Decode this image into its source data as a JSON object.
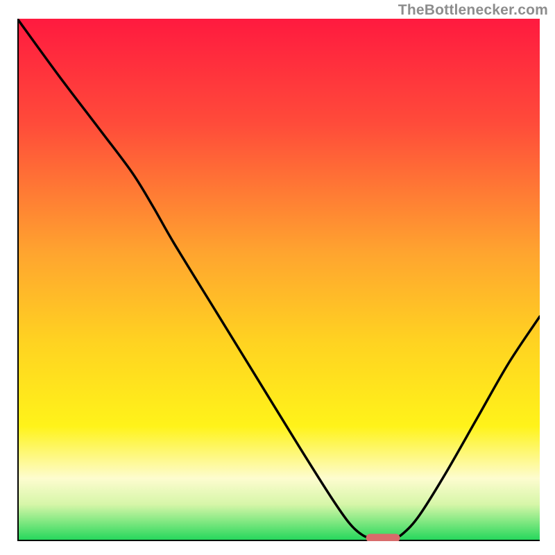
{
  "attribution": "TheBottlenecker.com",
  "chart_data": {
    "type": "line",
    "title": "",
    "xlabel": "",
    "ylabel": "",
    "xlim": [
      0,
      100
    ],
    "ylim": [
      0,
      100
    ],
    "grid": false,
    "legend": false,
    "background_gradient": {
      "stops": [
        {
          "pos": 0.0,
          "color": "#ff1a3f"
        },
        {
          "pos": 0.2,
          "color": "#ff4b3a"
        },
        {
          "pos": 0.45,
          "color": "#ffa52f"
        },
        {
          "pos": 0.62,
          "color": "#ffd321"
        },
        {
          "pos": 0.78,
          "color": "#fff31a"
        },
        {
          "pos": 0.88,
          "color": "#fdfccf"
        },
        {
          "pos": 0.93,
          "color": "#d6f6a8"
        },
        {
          "pos": 0.965,
          "color": "#7be77f"
        },
        {
          "pos": 1.0,
          "color": "#1fd65a"
        }
      ]
    },
    "series": [
      {
        "name": "curve",
        "color": "#000000",
        "points": [
          {
            "x": 0.0,
            "y": 100.0
          },
          {
            "x": 8.0,
            "y": 89.0
          },
          {
            "x": 16.0,
            "y": 78.5
          },
          {
            "x": 22.0,
            "y": 70.5
          },
          {
            "x": 26.0,
            "y": 64.0
          },
          {
            "x": 30.0,
            "y": 57.0
          },
          {
            "x": 38.0,
            "y": 44.0
          },
          {
            "x": 46.0,
            "y": 31.0
          },
          {
            "x": 54.0,
            "y": 18.0
          },
          {
            "x": 60.0,
            "y": 8.5
          },
          {
            "x": 63.5,
            "y": 3.5
          },
          {
            "x": 66.0,
            "y": 1.2
          },
          {
            "x": 68.0,
            "y": 0.6
          },
          {
            "x": 72.0,
            "y": 0.6
          },
          {
            "x": 74.0,
            "y": 1.6
          },
          {
            "x": 77.0,
            "y": 5.0
          },
          {
            "x": 82.0,
            "y": 13.0
          },
          {
            "x": 88.0,
            "y": 23.5
          },
          {
            "x": 94.0,
            "y": 34.0
          },
          {
            "x": 100.0,
            "y": 43.0
          }
        ]
      }
    ],
    "marker": {
      "shape": "pill",
      "color": "#d86b6b",
      "x_center": 70.0,
      "y_center": 0.6,
      "width": 6.5,
      "height": 1.6
    }
  }
}
